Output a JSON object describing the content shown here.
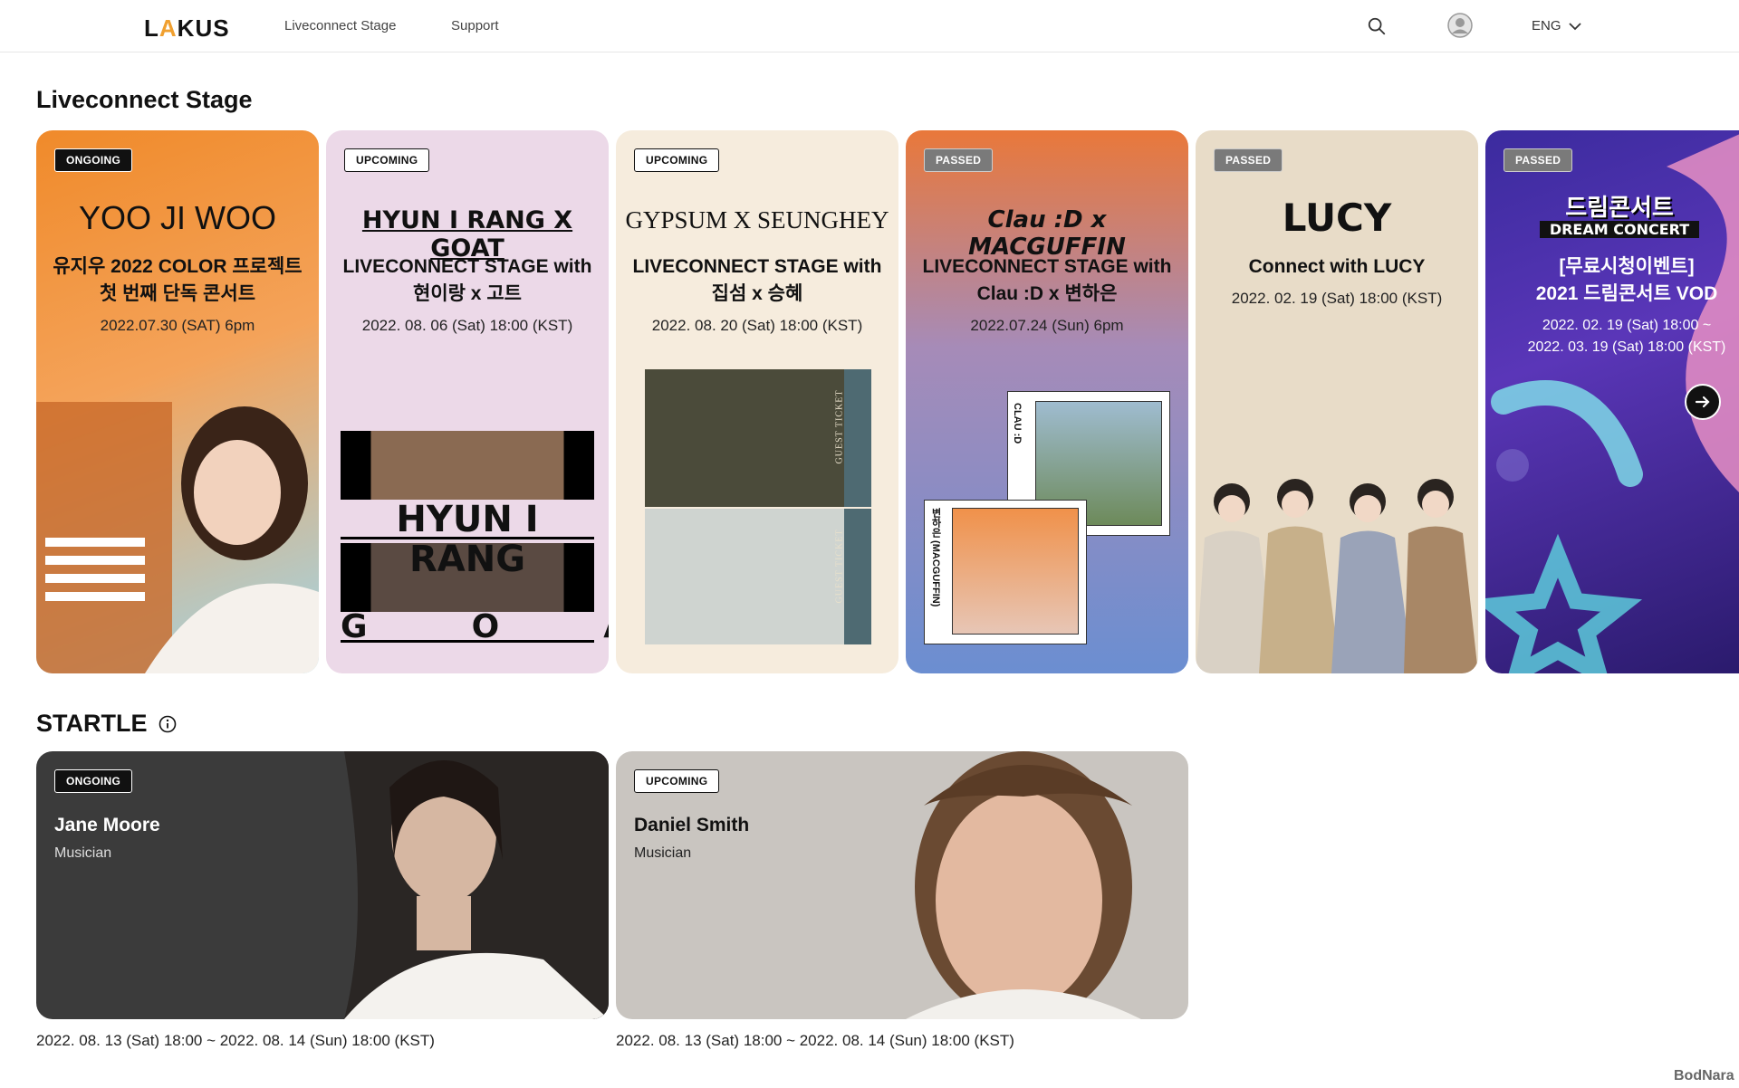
{
  "header": {
    "logo_left": "L",
    "logo_accent": "A",
    "logo_right": "KUS",
    "nav": [
      "Liveconnect Stage",
      "Support"
    ],
    "lang": "ENG"
  },
  "stage": {
    "title": "Liveconnect Stage",
    "cards": [
      {
        "badge": "ONGOING",
        "title": "YOO JI WOO",
        "sub1": "유지우 2022 COLOR 프로젝트",
        "sub2": "첫 번째 단독 콘서트",
        "date": "2022.07.30 (SAT) 6pm"
      },
      {
        "badge": "UPCOMING",
        "title": "HYUN I RANG X GOAT",
        "sub1": "LIVECONNECT STAGE with",
        "sub2": "현이랑 x 고트",
        "date": "2022. 08. 06 (Sat) 18:00 (KST)",
        "img_text1": "HYUN I RANG",
        "img_text2": "G  O  A  T"
      },
      {
        "badge": "UPCOMING",
        "title": "GYPSUM X SEUNGHEY",
        "sub1": "LIVECONNECT STAGE with",
        "sub2": "집섬 x 승혜",
        "date": "2022. 08. 20 (Sat) 18:00 (KST)",
        "ticket": "GUEST TICKET"
      },
      {
        "badge": "PASSED",
        "title": "Clau :D x MACGUFFIN",
        "sub1": "LIVECONNECT STAGE with",
        "sub2": "Clau :D x 변하은",
        "date": "2022.07.24 (Sun) 6pm",
        "photo1": "CLAU :D",
        "photo2": "변하은 (MACGUFFIN)"
      },
      {
        "badge": "PASSED",
        "title": "LUCY",
        "sub1": "Connect with LUCY",
        "date": "2022. 02. 19 (Sat) 18:00 (KST)"
      },
      {
        "badge": "PASSED",
        "title": "드림콘서트",
        "title_en": "DREAM CONCERT",
        "sub1": "[무료시청이벤트]",
        "sub2": "2021 드림콘서트 VOD",
        "date1": "2022. 02. 19 (Sat) 18:00 ~",
        "date2": "2022. 03. 19 (Sat) 18:00 (KST)"
      }
    ]
  },
  "startle": {
    "title": "STARTLE",
    "cards": [
      {
        "badge": "ONGOING",
        "name": "Jane Moore",
        "role": "Musician",
        "date": "2022. 08. 13 (Sat) 18:00 ~ 2022. 08. 14 (Sun) 18:00 (KST)"
      },
      {
        "badge": "UPCOMING",
        "name": "Daniel Smith",
        "role": "Musician",
        "date": "2022. 08. 13 (Sat) 18:00 ~ 2022. 08. 14 (Sun) 18:00 (KST)"
      }
    ]
  },
  "watermark": "BodNara"
}
